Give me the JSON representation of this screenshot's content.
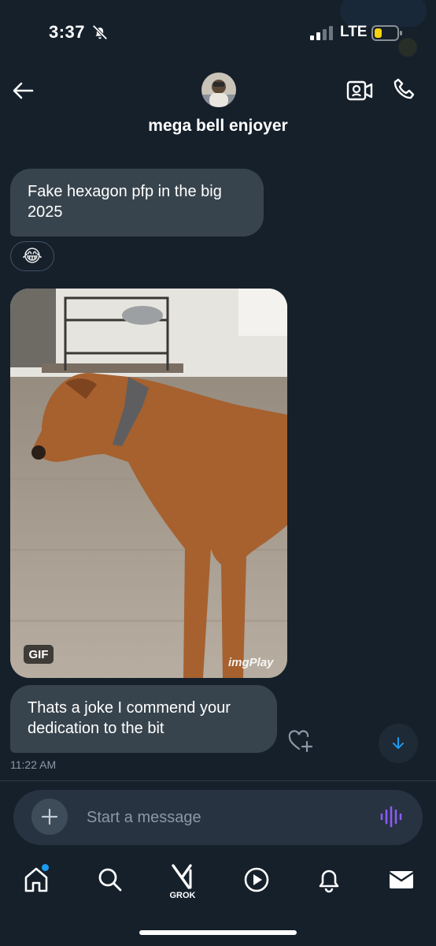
{
  "status_bar": {
    "time": "3:37",
    "network": "LTE"
  },
  "header": {
    "contact_name": "mega bell enjoyer"
  },
  "messages": [
    {
      "text": "Fake hexagon pfp in the big 2025",
      "reaction": "😂"
    },
    {
      "media_badge": "GIF",
      "watermark": "imgPlay"
    },
    {
      "text": "Thats a joke I commend your dedication to the bit",
      "time": "11:22 AM"
    }
  ],
  "composer": {
    "placeholder": "Start a message"
  },
  "tabbar": {
    "grok_label": "GROK"
  },
  "colors": {
    "background": "#15202b",
    "bubble": "#38444d",
    "accent": "#1d9bf0",
    "voice": "#8b5cf6"
  },
  "icons": [
    "back-arrow-icon",
    "video-call-icon",
    "phone-icon",
    "heart-plus-icon",
    "arrow-down-icon",
    "plus-icon",
    "voice-wave-icon",
    "home-icon",
    "search-icon",
    "grok-icon",
    "play-icon",
    "bell-icon",
    "mail-icon"
  ]
}
